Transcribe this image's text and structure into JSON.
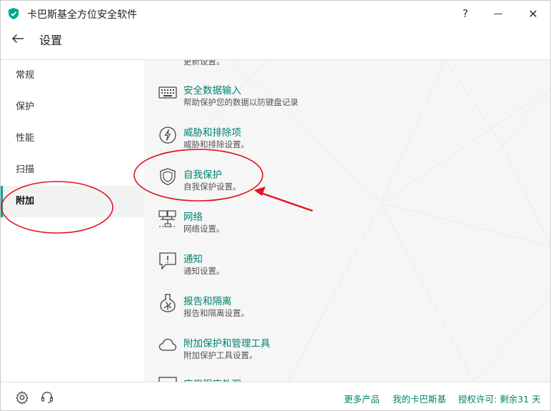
{
  "window": {
    "title": "卡巴斯基全方位安全软件",
    "help_label": "?",
    "minimize_label": "—",
    "close_label": "✕"
  },
  "header": {
    "title": "设置"
  },
  "sidebar": {
    "items": [
      {
        "label": "常规"
      },
      {
        "label": "保护"
      },
      {
        "label": "性能"
      },
      {
        "label": "扫描"
      },
      {
        "label": "附加"
      }
    ],
    "active": "附加"
  },
  "main": {
    "partial_top_text": "更新设置。",
    "rows": [
      {
        "title": "安全数据输入",
        "desc": "帮助保护您的数据以防键盘记录",
        "icon": "keyboard-icon"
      },
      {
        "title": "威胁和排除项",
        "desc": "威胁和排除设置。",
        "icon": "threat-lightning-icon"
      },
      {
        "title": "自我保护",
        "desc": "自我保护设置。",
        "icon": "shield-icon"
      },
      {
        "title": "网络",
        "desc": "网络设置。",
        "icon": "network-icon"
      },
      {
        "title": "通知",
        "desc": "通知设置。",
        "icon": "notification-icon"
      },
      {
        "title": "报告和隔离",
        "desc": "报告和隔离设置。",
        "icon": "flask-icon"
      },
      {
        "title": "附加保护和管理工具",
        "desc": "附加保护工具设置。",
        "icon": "cloud-icon"
      },
      {
        "title": "应用程序外观",
        "desc": "",
        "icon": "monitor-icon"
      }
    ]
  },
  "footer": {
    "more_products": "更多产品",
    "my_kaspersky": "我的卡巴斯基",
    "license": "授权许可: 剩余31 天",
    "icons": [
      "settings-gear-icon",
      "support-headset-icon"
    ]
  },
  "colors": {
    "accent": "#00a88e",
    "link": "#00836f",
    "annotation": "#e0141e"
  }
}
